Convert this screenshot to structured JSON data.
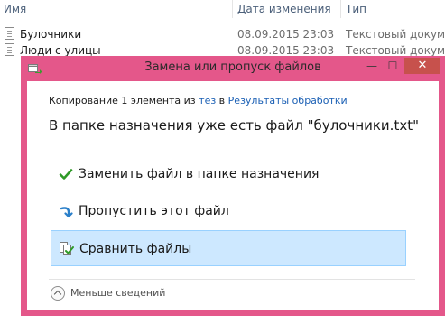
{
  "explorer": {
    "columns": {
      "name": "Имя",
      "date": "Дата изменения",
      "type": "Тип"
    },
    "files": [
      {
        "name": "Булочники",
        "date": "08.09.2015 23:03",
        "type": "Текстовый докум..."
      },
      {
        "name": "Люди с улицы",
        "date": "08.09.2015 23:03",
        "type": "Текстовый докум..."
      }
    ]
  },
  "dialog": {
    "title": "Замена или пропуск файлов",
    "buttons": {
      "minimize": "—",
      "maximize": "☐",
      "close": "✕"
    },
    "copy_prefix": "Копирование 1 элемента из ",
    "source_link": "тез",
    "copy_middle": " в ",
    "dest_link": "Результаты обработки",
    "heading": "В папке назначения уже есть файл \"булочники.txt\"",
    "options": {
      "replace": {
        "label": "Заменить файл в папке назначения",
        "icon": "checkmark-icon"
      },
      "skip": {
        "label": "Пропустить этот файл",
        "icon": "skip-arrow-icon"
      },
      "compare": {
        "label": "Сравнить файлы",
        "icon": "compare-files-icon"
      }
    },
    "details_label": "Меньше сведений"
  },
  "colors": {
    "frame": "#e4578a",
    "close_button": "#c7514c",
    "selected_option": "#cde8ff",
    "link": "#1a5fb4"
  }
}
